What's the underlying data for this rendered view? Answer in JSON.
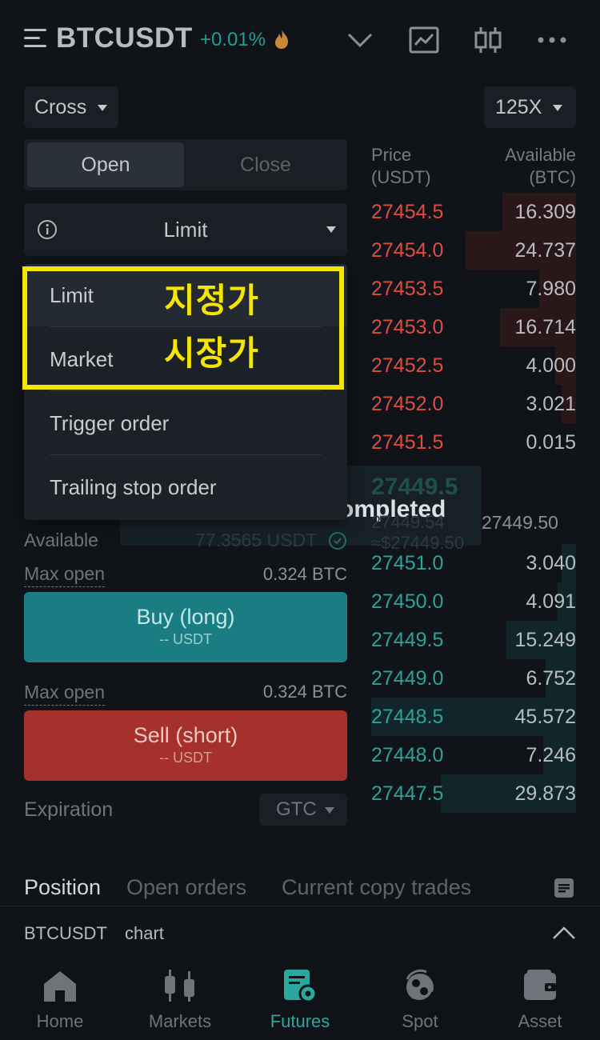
{
  "header": {
    "pair": "BTCUSDT",
    "change": "+0.01%"
  },
  "selectors": {
    "margin_mode": "Cross",
    "leverage": "125X"
  },
  "order_tabs": {
    "open": "Open",
    "close": "Close"
  },
  "order_type": {
    "selected": "Limit"
  },
  "dropdown": {
    "items": [
      "Limit",
      "Market",
      "Trigger order",
      "Trailing stop order"
    ]
  },
  "annotation": {
    "line1": "지정가",
    "line2": "시장가"
  },
  "order_book": {
    "price_header": [
      "Price",
      "(USDT)"
    ],
    "qty_header": [
      "Available",
      "(BTC)"
    ],
    "asks": [
      {
        "price": "27454.5",
        "qty": "16.309",
        "depth": 0.36
      },
      {
        "price": "27454.0",
        "qty": "24.737",
        "depth": 0.54
      },
      {
        "price": "27453.5",
        "qty": "7.980",
        "depth": 0.18
      },
      {
        "price": "27453.0",
        "qty": "16.714",
        "depth": 0.37
      },
      {
        "price": "27452.5",
        "qty": "4.000",
        "depth": 0.1
      },
      {
        "price": "27452.0",
        "qty": "3.021",
        "depth": 0.07
      },
      {
        "price": "27451.5",
        "qty": "0.015",
        "depth": 0.0
      }
    ],
    "last_price": "27449.5",
    "mark_price": "27449.54 ≈$27449.50",
    "toast": "ompleted",
    "bids": [
      {
        "price": "27451.0",
        "qty": "3.040",
        "depth": 0.07
      },
      {
        "price": "27450.0",
        "qty": "4.091",
        "depth": 0.09
      },
      {
        "price": "27449.5",
        "qty": "15.249",
        "depth": 0.34
      },
      {
        "price": "27449.0",
        "qty": "6.752",
        "depth": 0.15
      },
      {
        "price": "27448.5",
        "qty": "45.572",
        "depth": 1.0
      },
      {
        "price": "27448.0",
        "qty": "7.246",
        "depth": 0.16
      },
      {
        "price": "27447.5",
        "qty": "29.873",
        "depth": 0.66
      }
    ]
  },
  "account": {
    "available_label": "Available",
    "available_value": "77.3565 USDT",
    "max_open_label": "Max open",
    "max_open_long": "0.324 BTC",
    "max_open_short": "0.324 BTC"
  },
  "buttons": {
    "buy_title": "Buy (long)",
    "buy_sub": "-- USDT",
    "sell_title": "Sell (short)",
    "sell_sub": "-- USDT"
  },
  "expiration": {
    "label": "Expiration",
    "value": "GTC"
  },
  "position_tabs": [
    "Position",
    "Open orders",
    "Current copy trades"
  ],
  "chart_bar": {
    "pair": "BTCUSDT",
    "label": "chart"
  },
  "nav": [
    {
      "label": "Home"
    },
    {
      "label": "Markets"
    },
    {
      "label": "Futures"
    },
    {
      "label": "Spot"
    },
    {
      "label": "Asset"
    }
  ],
  "colors": {
    "ask": "#e04b43",
    "bid": "#2aa497",
    "buy": "#1a7d83",
    "sell": "#a6302b",
    "highlight": "#f5e600"
  }
}
